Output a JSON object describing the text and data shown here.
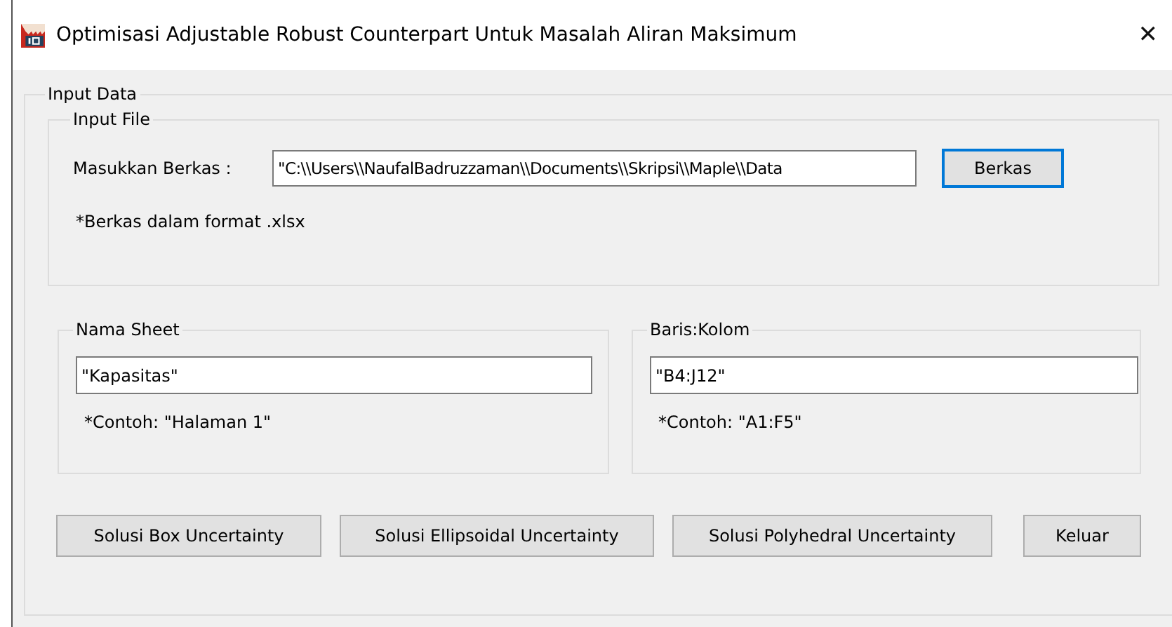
{
  "window": {
    "title": "Optimisasi Adjustable Robust Counterpart Untuk Masalah Aliran Maksimum",
    "close": "✕"
  },
  "input_data": {
    "title": "Input Data",
    "input_file": {
      "title": "Input File",
      "label": "Masukkan Berkas :",
      "value": "\"C:\\\\Users\\\\NaufalBadruzzaman\\\\Documents\\\\Skripsi\\\\Maple\\\\Data",
      "button": "Berkas",
      "note": "*Berkas dalam format .xlsx"
    },
    "groups": [
      {
        "title": "Nama Sheet",
        "value": "\"Kapasitas\"",
        "note": "*Contoh: \"Halaman 1\""
      },
      {
        "title": "Baris:Kolom",
        "value": "\"B4:J12\"",
        "note": "*Contoh: \"A1:F5\""
      }
    ],
    "buttons": [
      "Solusi Box Uncertainty",
      "Solusi Ellipsoidal Uncertainty",
      "Solusi Polyhedral Uncertainty",
      "Keluar"
    ]
  }
}
